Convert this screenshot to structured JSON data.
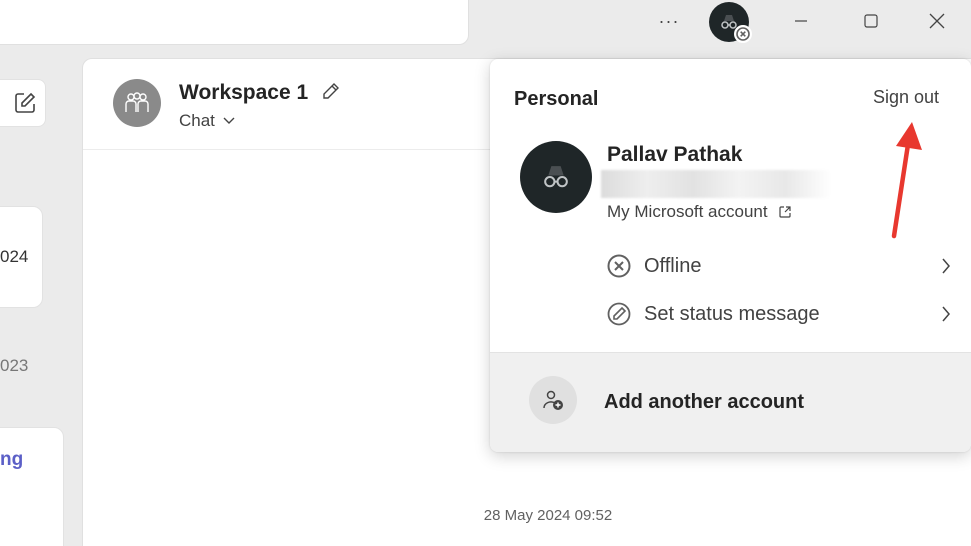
{
  "titlebar": {
    "more_glyph": "···"
  },
  "left_pane": {
    "card_date_fragment": "024",
    "date_fragment": "023",
    "card_text_fragment": "ng"
  },
  "chat_header": {
    "title": "Workspace 1",
    "subtitle": "Chat"
  },
  "conversation": {
    "timestamp": "28 May 2024 09:52"
  },
  "account_menu": {
    "heading": "Personal",
    "sign_out": "Sign out",
    "user_name": "Pallav Pathak",
    "ms_account_link": "My Microsoft account",
    "status_label": "Offline",
    "status_message_label": "Set status message",
    "add_account_label": "Add another account"
  },
  "colors": {
    "accent": "#5b5fc7",
    "annotation_arrow": "#e8382f",
    "offline_status": "#616161"
  },
  "icons": [
    "more-icon",
    "profile-avatar-icon",
    "offline-status-icon",
    "minimize-icon",
    "maximize-icon",
    "close-icon",
    "compose-icon",
    "group-icon",
    "edit-pencil-icon",
    "chevron-down-icon",
    "external-link-icon",
    "chevron-right-icon",
    "status-message-icon",
    "add-person-icon"
  ]
}
